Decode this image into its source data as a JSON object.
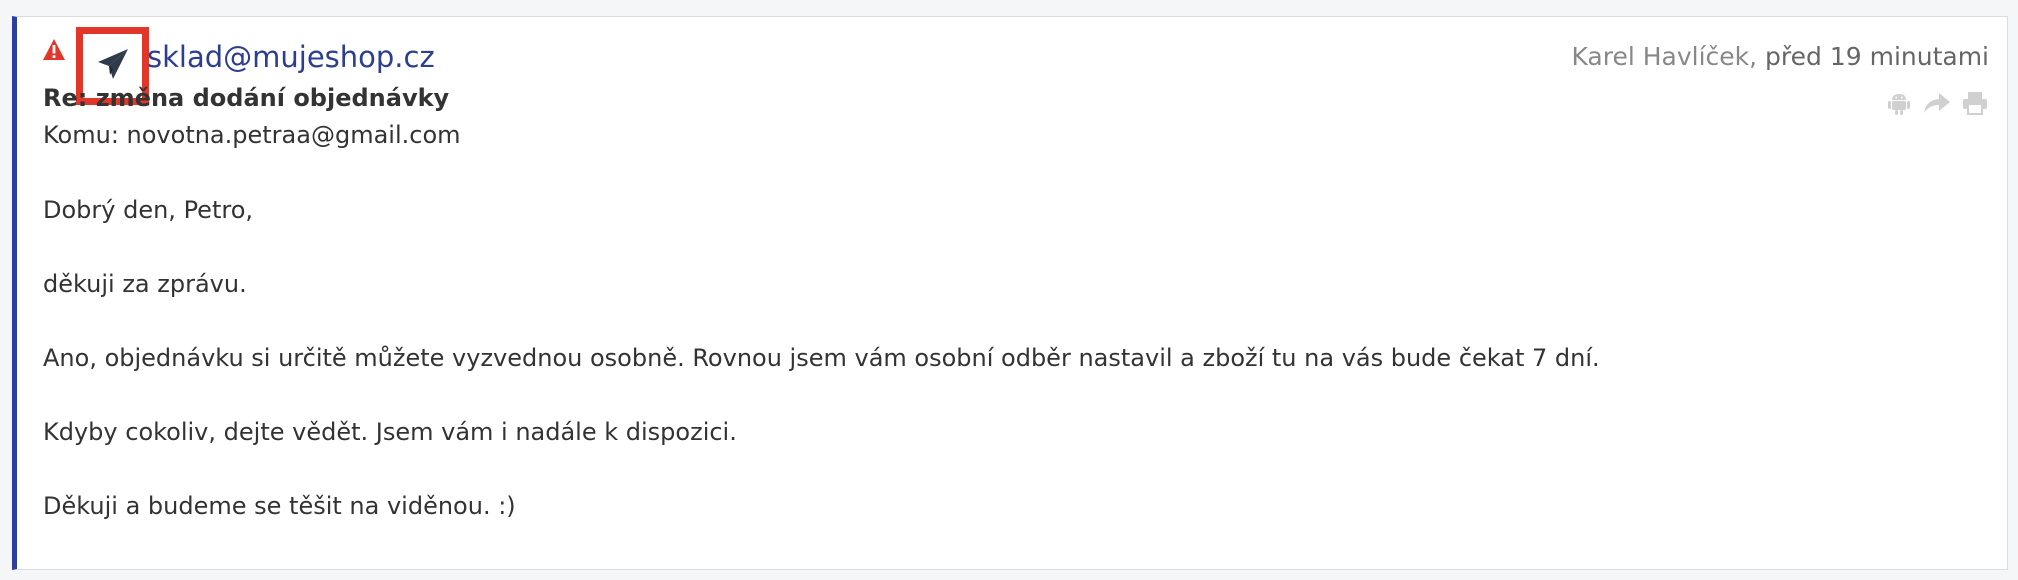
{
  "message": {
    "from": "sklad@mujeshop.cz",
    "author": "Karel Havlíček",
    "separator": ", ",
    "time": "před 19 minutami",
    "subject": "Re: změna dodání objednávky",
    "to_label": "Komu: novotna.petraa@gmail.com",
    "body": [
      "Dobrý den, Petro,",
      "děkuji za zprávu.",
      "Ano, objednávku si určitě můžete vyzvednou osobně. Rovnou jsem vám osobní odběr nastavil a zboží tu na vás bude čekat 7 dní.",
      "Kdyby cokoliv, dejte vědět. Jsem vám i nadále k dispozici.",
      "Děkuji a budeme se těšit na viděnou. :)"
    ]
  },
  "icons": {
    "warning": "warning-triangle-icon",
    "sent": "paper-plane-icon",
    "android": "android-icon",
    "forward": "share-arrow-icon",
    "print": "print-icon"
  },
  "colors": {
    "accent_border": "#2c3e9e",
    "sender_link": "#2c3e8f",
    "warning": "#e3362b",
    "highlight_box": "#e3362b",
    "action_icons": "#d0d0d0"
  }
}
